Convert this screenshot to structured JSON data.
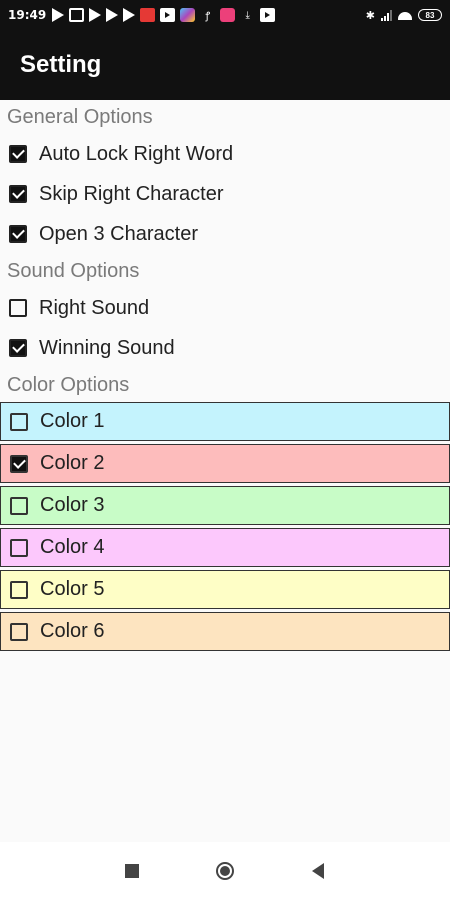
{
  "status_bar": {
    "time": "19:49",
    "battery": "83"
  },
  "app_bar": {
    "title": "Setting"
  },
  "sections": {
    "general": {
      "header": "General Options",
      "options": [
        {
          "label": "Auto Lock Right Word",
          "checked": true
        },
        {
          "label": "Skip Right Character",
          "checked": true
        },
        {
          "label": "Open 3 Character",
          "checked": true
        }
      ]
    },
    "sound": {
      "header": "Sound Options",
      "options": [
        {
          "label": "Right Sound",
          "checked": false
        },
        {
          "label": "Winning Sound",
          "checked": true
        }
      ]
    },
    "color": {
      "header": "Color Options",
      "options": [
        {
          "label": "Color 1",
          "checked": false,
          "color": "#c4f3fd"
        },
        {
          "label": "Color 2",
          "checked": true,
          "color": "#fdbcbc"
        },
        {
          "label": "Color 3",
          "checked": false,
          "color": "#c8fcc7"
        },
        {
          "label": "Color 4",
          "checked": false,
          "color": "#fcc8fc"
        },
        {
          "label": "Color 5",
          "checked": false,
          "color": "#fefec6"
        },
        {
          "label": "Color 6",
          "checked": false,
          "color": "#fde4c0"
        }
      ]
    }
  },
  "nav_bar": {
    "icons": [
      "recents-icon",
      "home-icon",
      "back-icon"
    ]
  }
}
